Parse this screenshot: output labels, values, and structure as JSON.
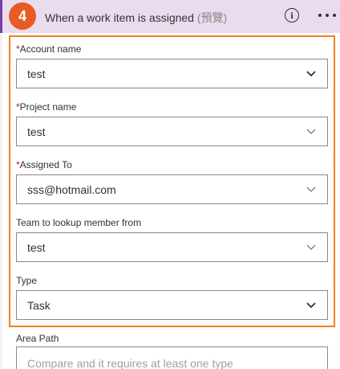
{
  "header": {
    "step_number": "4",
    "title": "When a work item is assigned",
    "tag": "(預覽)"
  },
  "fields": [
    {
      "label": "Account name",
      "required": true,
      "value": "test",
      "chevron": "dark"
    },
    {
      "label": "Project name",
      "required": true,
      "value": "test",
      "chevron": "light"
    },
    {
      "label": "Assigned To",
      "required": true,
      "value": "sss@hotmail.com",
      "chevron": "light"
    },
    {
      "label": "Team to lookup member from",
      "required": false,
      "value": "test",
      "chevron": "light"
    },
    {
      "label": "Type",
      "required": false,
      "value": "Task",
      "chevron": "dark"
    }
  ],
  "area_path": {
    "label": "Area Path",
    "placeholder": "Compare and it requires at least one type"
  },
  "required_marker": "*",
  "colors": {
    "accent_purple": "#7b3fa0",
    "header_bg": "#e9dcef",
    "badge": "#e85b24",
    "highlight_border": "#f07f1d",
    "required": "#a4262c"
  }
}
